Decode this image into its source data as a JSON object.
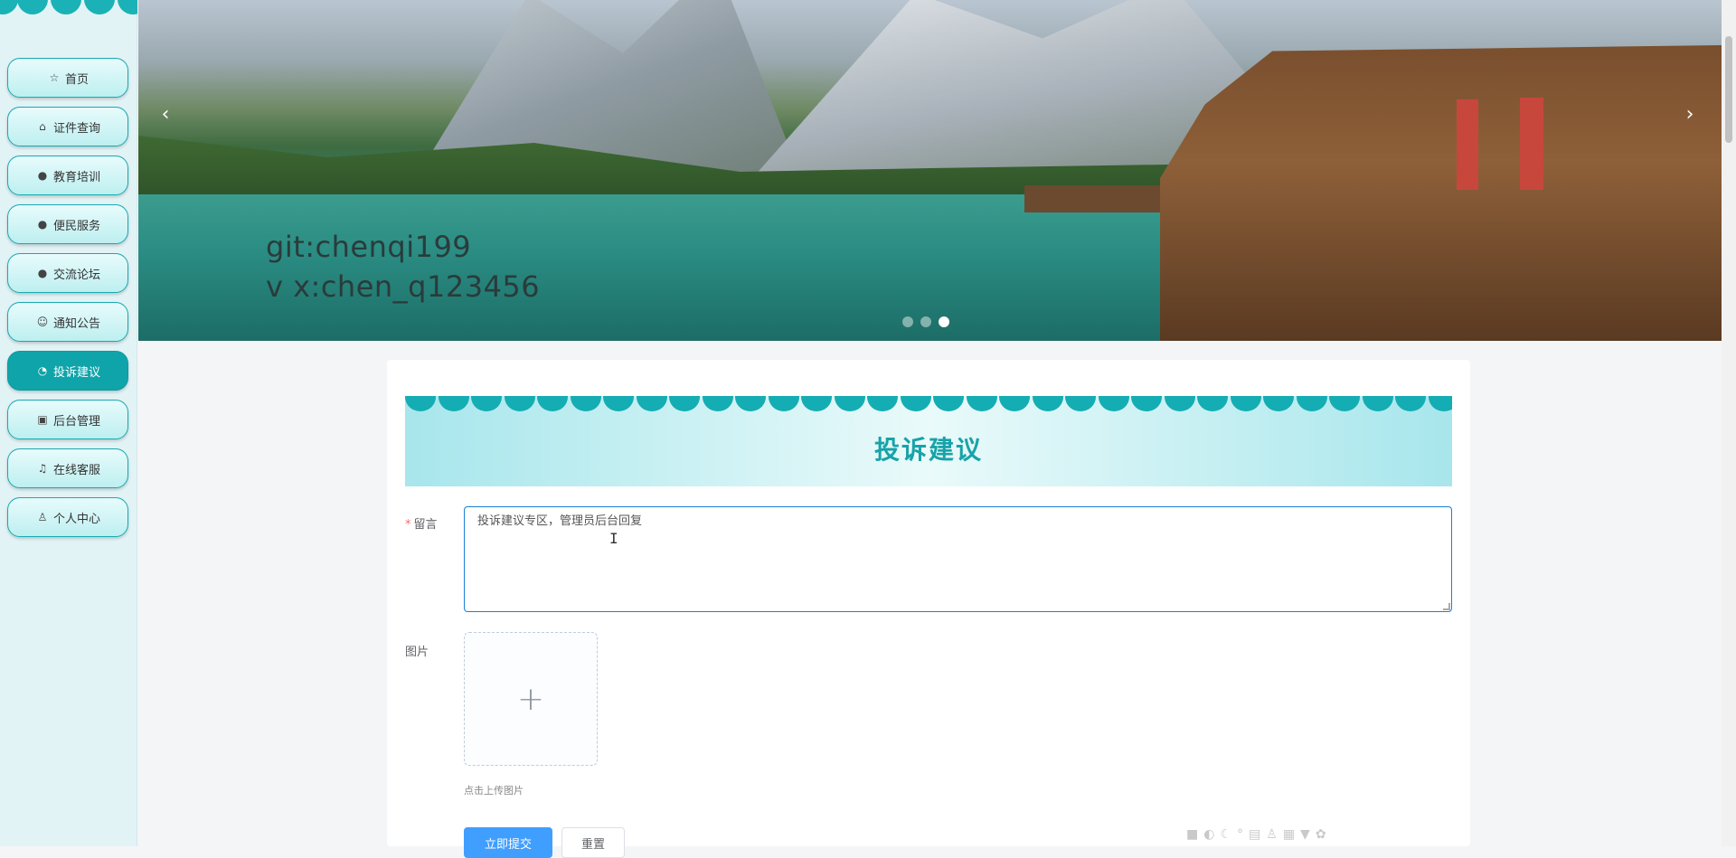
{
  "sidebar": {
    "items": [
      {
        "label": "首页",
        "icon": "star-icon",
        "glyph": "☆"
      },
      {
        "label": "证件查询",
        "icon": "briefcase-icon",
        "glyph": "⌂"
      },
      {
        "label": "教育培训",
        "icon": "alert-circle-icon",
        "glyph": "●"
      },
      {
        "label": "便民服务",
        "icon": "help-circle-icon",
        "glyph": "●"
      },
      {
        "label": "交流论坛",
        "icon": "info-circle-icon",
        "glyph": "●"
      },
      {
        "label": "通知公告",
        "icon": "smile-icon",
        "glyph": "☺"
      },
      {
        "label": "投诉建议",
        "icon": "chat-icon",
        "glyph": "◔",
        "active": true
      },
      {
        "label": "后台管理",
        "icon": "toolbox-icon",
        "glyph": "▣"
      },
      {
        "label": "在线客服",
        "icon": "headset-icon",
        "glyph": "♫"
      },
      {
        "label": "个人中心",
        "icon": "user-icon",
        "glyph": "♙"
      }
    ]
  },
  "banner": {
    "line1": "git:chenqi199",
    "line2": "v x:chen_q123456",
    "prev": "‹",
    "next": "›",
    "slide_count": 3,
    "active_slide": 3
  },
  "form": {
    "title": "投诉建议",
    "message_label": "留言",
    "message_required_mark": "*",
    "message_value": "投诉建议专区，管理员后台回复",
    "image_label": "图片",
    "upload_plus": "+",
    "upload_tip": "点击上传图片",
    "submit_label": "立即提交",
    "reset_label": "重置"
  },
  "colors": {
    "accent": "#17a3a9",
    "primary_button": "#409eff",
    "sidebar_bg": "#e2f3f6"
  }
}
